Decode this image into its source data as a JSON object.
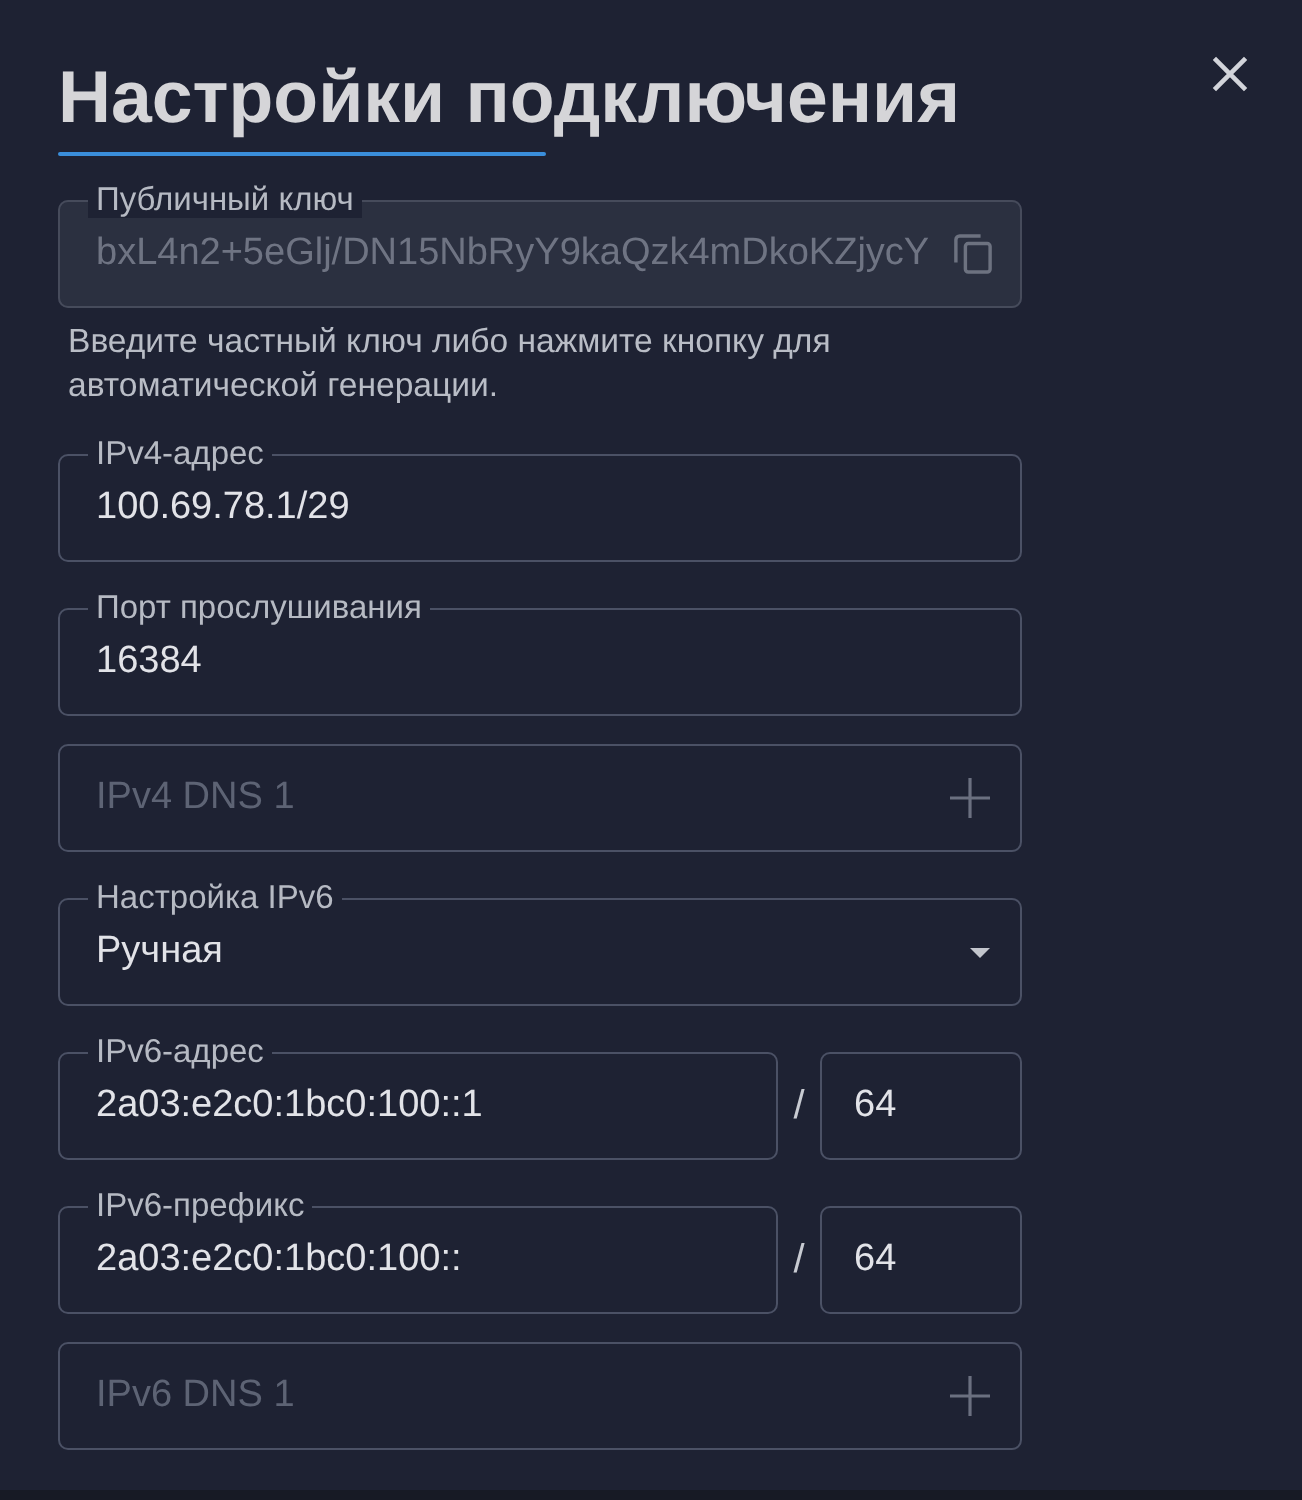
{
  "dialog": {
    "title": "Настройки подключения"
  },
  "fields": [
    {
      "kind": "copy",
      "label": "Публичный ключ",
      "value": "bxL4n2+5eGlj/DN15NbRyY9kaQzk4mDkoKZjycY",
      "disabled": true,
      "hint": "Введите частный ключ либо нажмите кнопку для автоматической генерации."
    },
    {
      "kind": "text",
      "label": "IPv4-адрес",
      "value": "100.69.78.1/29",
      "disabled": false
    },
    {
      "kind": "text",
      "label": "Порт прослушивания",
      "value": "16384",
      "disabled": false
    },
    {
      "kind": "add",
      "placeholder": "IPv4 DNS 1",
      "disabled": false
    },
    {
      "kind": "select",
      "label": "Настройка IPv6",
      "value": "Ручная",
      "disabled": false
    },
    {
      "kind": "prefixed",
      "label": "IPv6-адрес",
      "value": "2a03:e2c0:1bc0:100::1",
      "separator": "/",
      "prefix": "64",
      "disabled": false
    },
    {
      "kind": "prefixed",
      "label": "IPv6-префикс",
      "value": "2a03:e2c0:1bc0:100::",
      "separator": "/",
      "prefix": "64",
      "disabled": false
    },
    {
      "kind": "add",
      "placeholder": "IPv6 DNS 1",
      "disabled": false
    }
  ]
}
